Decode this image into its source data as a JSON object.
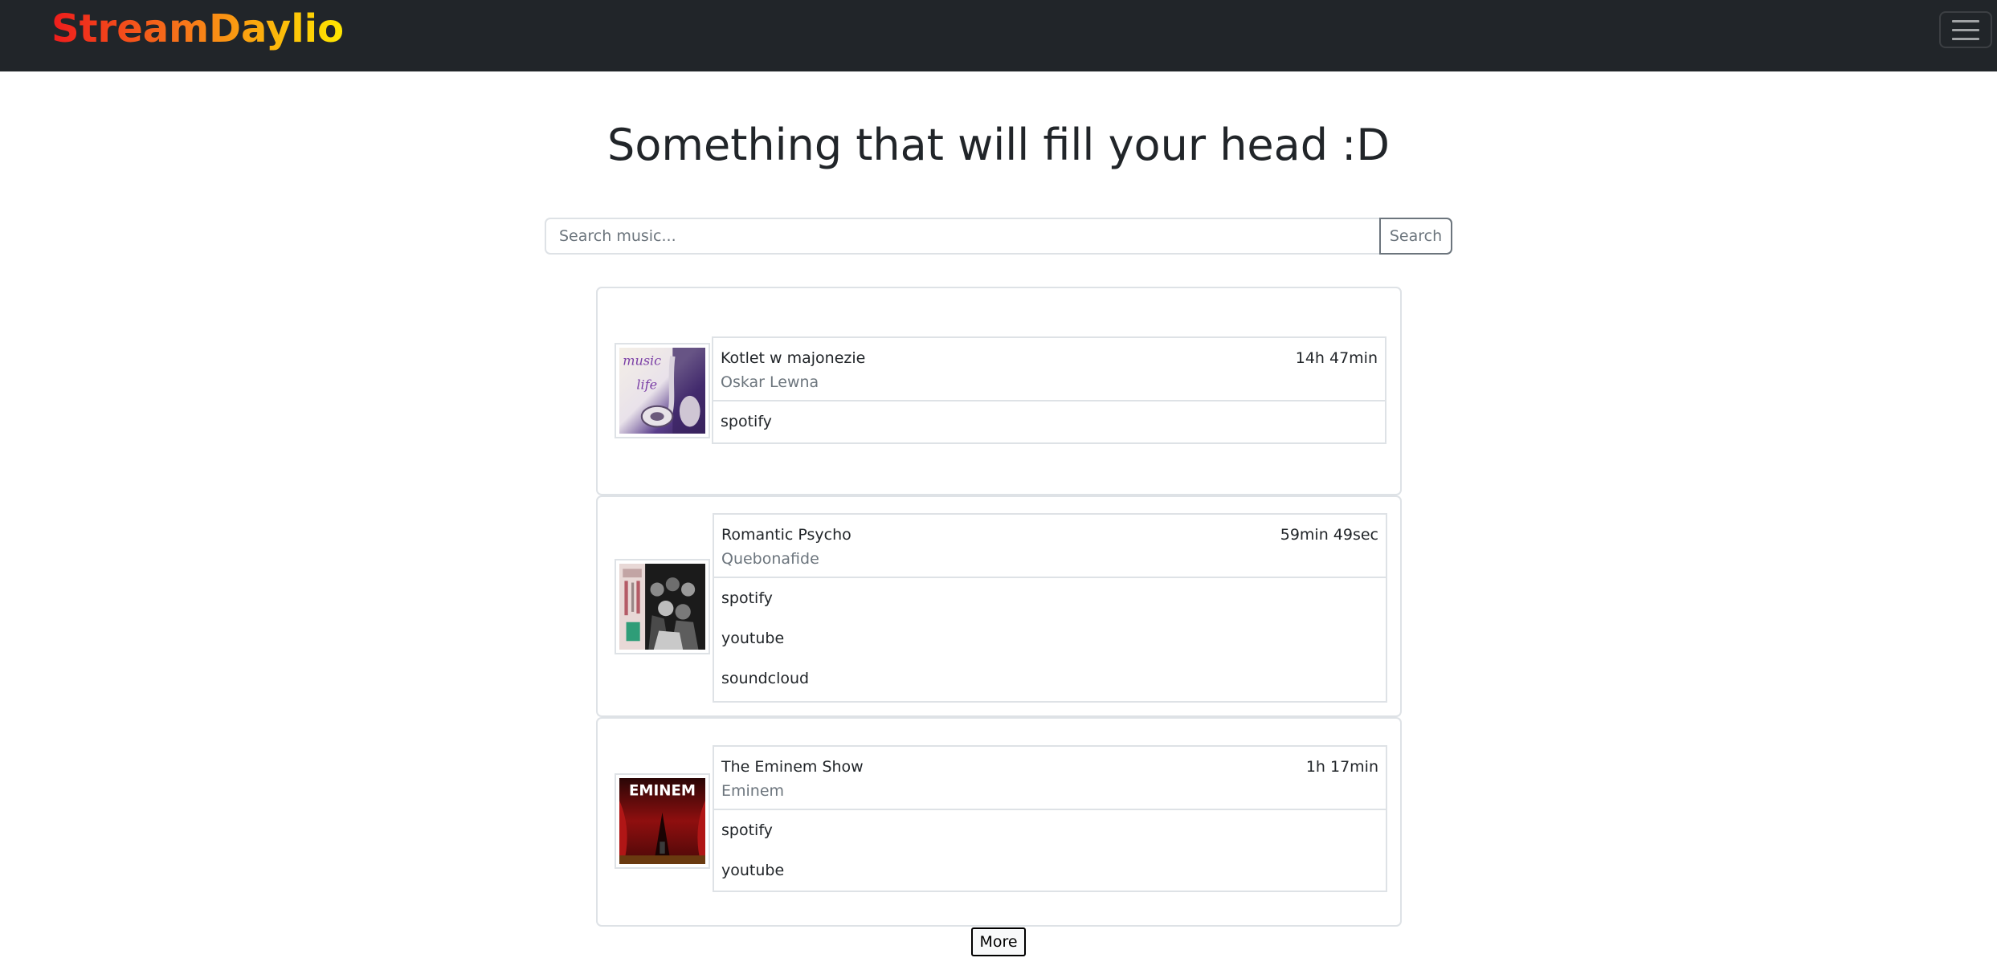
{
  "navbar": {
    "brand": "StreamDaylio",
    "menu_icon": "hamburger-menu-icon",
    "brand_gradient": [
      "#ee1c1c",
      "#f7751a",
      "#ffe800"
    ],
    "background": "#212529"
  },
  "main": {
    "heading": "Something that will fill your head :D"
  },
  "search": {
    "placeholder": "Search music...",
    "value": "",
    "button_label": "Search"
  },
  "albums": [
    {
      "title": "Kotlet w majonezie",
      "artist": "Oskar Lewna",
      "duration": "14h 47min",
      "cover_icon": "album-cover-earphones",
      "sources": [
        "spotify"
      ]
    },
    {
      "title": "Romantic Psycho",
      "artist": "Quebonafide",
      "duration": "59min 49sec",
      "cover_icon": "album-cover-group-photo",
      "sources": [
        "spotify",
        "youtube",
        "soundcloud"
      ]
    },
    {
      "title": "The Eminem Show",
      "artist": "Eminem",
      "duration": "1h 17min",
      "cover_icon": "album-cover-eminem-show",
      "cover_text": "EMINEM",
      "sources": [
        "spotify",
        "youtube"
      ]
    }
  ],
  "pagination": {
    "more_label": "More"
  }
}
